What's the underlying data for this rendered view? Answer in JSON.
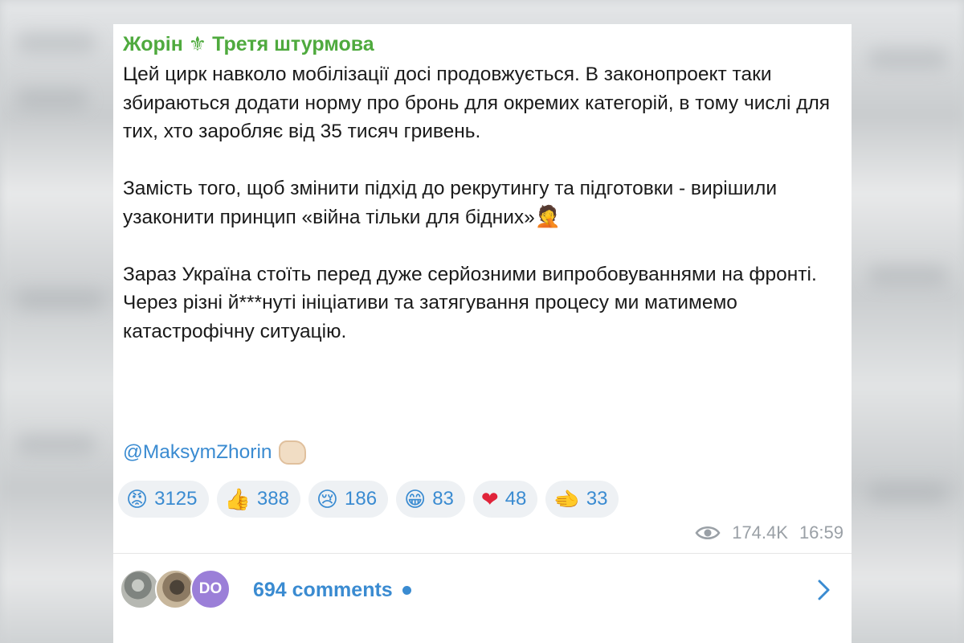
{
  "post": {
    "author": "Жорін ⚜ Третя штурмова",
    "paragraphs": [
      "Цей цирк навколо мобілізації досі продовжується. В законопроект таки збираються додати норму про бронь для окремих категорій, в тому числі для тих, хто заробляє від 35 тисяч гривень.",
      "Замість того, щоб змінити підхід до рекрутингу та підготовки - вирішили узаконити принцип «війна тільки для бідних»",
      "Зараз Україна стоїть перед дуже серйозними випробовуваннями на фронті. Через різні й***нуті ініціативи та затягування процесу ми матимемо катастрофічну ситуацію."
    ],
    "paragraph2_emoji": "🤦",
    "mention": "@MaksymZhorin",
    "mention_emoji_icon": "fist-bump-icon",
    "reactions": [
      {
        "icon": "angry-face-icon",
        "glyph": "😡",
        "count": "3125"
      },
      {
        "icon": "thumbs-up-icon",
        "glyph": "👍",
        "count": "388"
      },
      {
        "icon": "crying-face-icon",
        "glyph": "😢",
        "count": "186"
      },
      {
        "icon": "grinning-face-icon",
        "glyph": "😁",
        "count": "83"
      },
      {
        "icon": "red-heart-icon",
        "glyph": "❤",
        "count": "48"
      },
      {
        "icon": "hand-icon",
        "glyph": "🫲",
        "count": "33"
      }
    ],
    "views": "174.4K",
    "time": "16:59"
  },
  "comments": {
    "label": "694 comments",
    "avatar_initials": "DO"
  },
  "colors": {
    "author": "#4faa3e",
    "link": "#3a8bd1",
    "meta": "#9aa0a6",
    "reaction_bg": "#eef1f4"
  }
}
